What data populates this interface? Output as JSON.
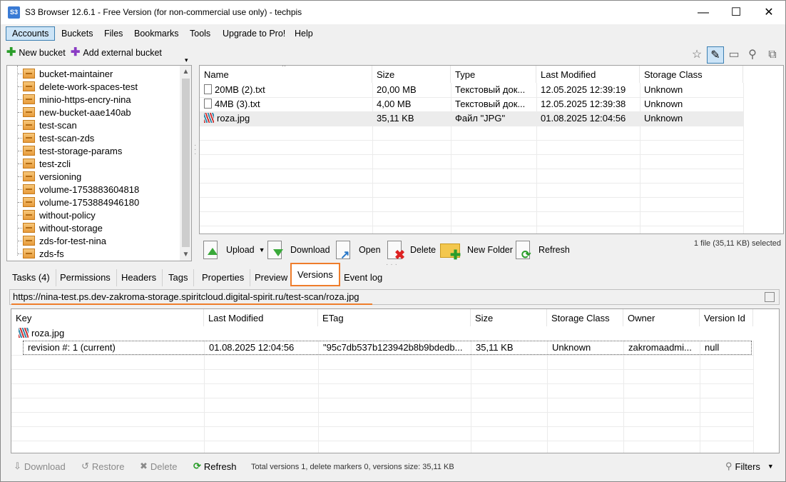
{
  "window": {
    "icon_label": "S3",
    "title": "S3 Browser 12.6.1 - Free Version (for non-commercial use only) - techpis",
    "minimize": "—",
    "maximize": "☐",
    "close": "✕"
  },
  "menu": [
    "Accounts",
    "Buckets",
    "Files",
    "Bookmarks",
    "Tools",
    "Upgrade to Pro!",
    "Help"
  ],
  "left_toolbar": {
    "new_bucket": "New bucket",
    "add_external": "Add external bucket"
  },
  "buckets": [
    "bucket-maintainer",
    "delete-work-spaces-test",
    "minio-https-encry-nina",
    "new-bucket-aae140ab",
    "test-scan",
    "test-scan-zds",
    "test-storage-params",
    "test-zcli",
    "versioning",
    "volume-1753883604818",
    "volume-1753884946180",
    "without-policy",
    "without-storage",
    "zds-for-test-nina",
    "zds-fs"
  ],
  "files": {
    "columns": [
      "Name",
      "Size",
      "Type",
      "Last Modified",
      "Storage Class"
    ],
    "rows": [
      {
        "name": "20MB (2).txt",
        "size": "20,00 MB",
        "type": "Текстовый док...",
        "modified": "12.05.2025 12:39:19",
        "storage": "Unknown"
      },
      {
        "name": "4MB (3).txt",
        "size": "4,00 MB",
        "type": "Текстовый док...",
        "modified": "12.05.2025 12:39:38",
        "storage": "Unknown"
      },
      {
        "name": "roza.jpg",
        "size": "35,11 KB",
        "type": "Файл \"JPG\"",
        "modified": "01.08.2025 12:04:56",
        "storage": "Unknown"
      }
    ]
  },
  "actions": {
    "upload": "Upload",
    "download": "Download",
    "open": "Open",
    "delete": "Delete",
    "new_folder": "New Folder",
    "refresh": "Refresh",
    "selection": "1 file (35,11 KB) selected"
  },
  "tabs": [
    "Tasks (4)",
    "Permissions",
    "Headers",
    "Tags",
    "Properties",
    "Preview",
    "Versions",
    "Event log"
  ],
  "url": "https://nina-test.ps.dev-zakroma-storage.spiritcloud.digital-spirit.ru/test-scan/roza.jpg",
  "versions": {
    "columns": [
      "Key",
      "Last Modified",
      "ETag",
      "Size",
      "Storage Class",
      "Owner",
      "Version Id"
    ],
    "key": "roza.jpg",
    "rows": [
      {
        "key": "revision #: 1 (current)",
        "modified": "01.08.2025 12:04:56",
        "etag": "\"95c7db537b123942b8b9bdedb...",
        "size": "35,11 KB",
        "storage": "Unknown",
        "owner": "zakromaadmi...",
        "version": "null"
      }
    ]
  },
  "bottom": {
    "download": "Download",
    "restore": "Restore",
    "delete": "Delete",
    "refresh": "Refresh",
    "status": "Total versions 1, delete markers 0, versions size: 35,11 KB",
    "filters": "Filters"
  }
}
